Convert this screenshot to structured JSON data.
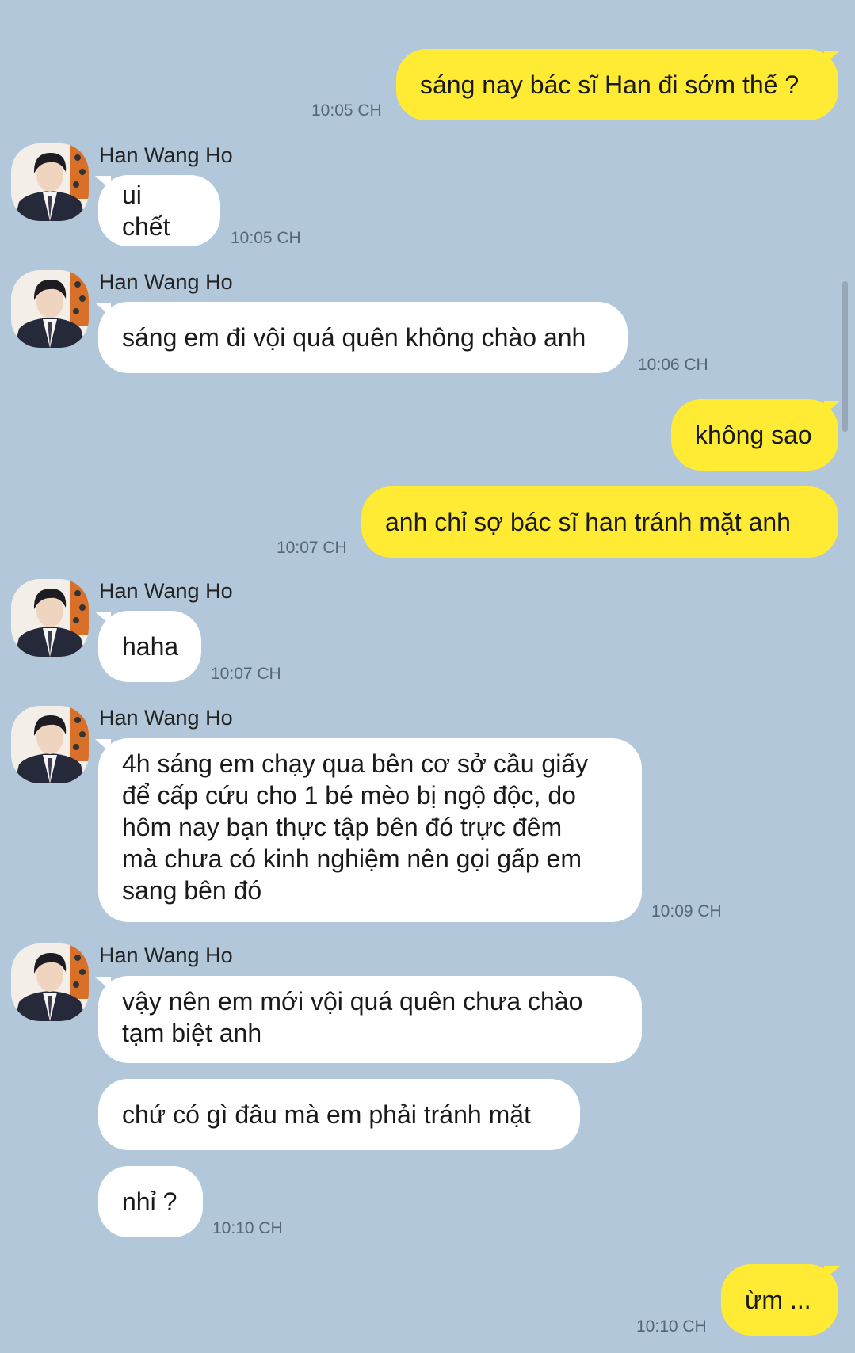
{
  "contact": {
    "name": "Han Wang Ho"
  },
  "messages": [
    {
      "sender": "me",
      "text": "sáng nay bác sĩ Han đi sớm thế ?",
      "time": "10:05 CH"
    },
    {
      "sender": "other",
      "text": "ui chết",
      "time": "10:05 CH"
    },
    {
      "sender": "other",
      "text": "sáng em đi vội quá quên không chào anh",
      "time": "10:06 CH"
    },
    {
      "sender": "me",
      "text": "không sao"
    },
    {
      "sender": "me",
      "text": "anh chỉ sợ bác sĩ han tránh mặt anh",
      "time": "10:07 CH"
    },
    {
      "sender": "other",
      "text": "haha",
      "time": "10:07 CH"
    },
    {
      "sender": "other",
      "lines": [
        "4h sáng em chạy qua bên cơ sở cầu giấy",
        "để cấp cứu cho 1 bé mèo bị ngộ độc, do",
        "hôm nay bạn thực tập bên đó trực đêm",
        "mà chưa có kinh nghiệm nên gọi gấp em",
        "sang bên đó"
      ],
      "time": "10:09 CH"
    },
    {
      "sender": "other",
      "lines": [
        "vậy nên em mới vội quá quên chưa chào",
        "tạm biệt anh"
      ]
    },
    {
      "sender": "other",
      "text": "chứ có gì đâu mà em phải tránh mặt"
    },
    {
      "sender": "other",
      "text": "nhỉ ?",
      "time": "10:10 CH"
    },
    {
      "sender": "me",
      "text": "ừm ...",
      "time": "10:10 CH"
    }
  ],
  "colors": {
    "background": "#b2c7d9",
    "my_bubble": "#ffeb33",
    "their_bubble": "#ffffff"
  }
}
